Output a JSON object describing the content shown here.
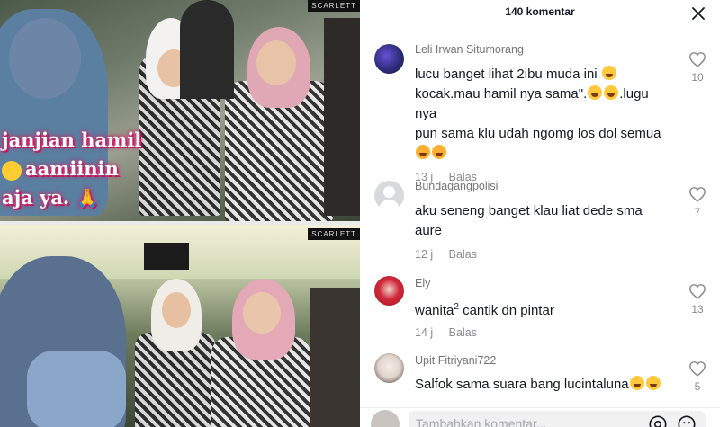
{
  "video": {
    "caption_lines": [
      "janjian hamil",
      "aamiinin",
      "aja ya."
    ],
    "watermark": "SCARLETT"
  },
  "panel": {
    "comment_count_title": "140 komentar",
    "comments": [
      {
        "username": "Leli Irwan Situmorang",
        "text": "lucu banget lihat 2ibu muda ini 😁 kocak.mau hamil nya sama\".😂😂.lugu nya pun sama klu udah ngomg los dol semua 🥰🥰",
        "text_parts": [
          "lucu banget lihat 2ibu muda ini",
          "kocak.mau hamil nya sama\".",
          ".lugu nya",
          "pun sama klu udah ngomg los dol semua"
        ],
        "time": "13 j",
        "reply_label": "Balas",
        "likes": "10"
      },
      {
        "username": "Bundagangpolisi",
        "text": "aku seneng banget klau liat dede sma aure",
        "text_parts": [
          "aku seneng banget klau liat dede sma",
          "aure"
        ],
        "time": "12 j",
        "reply_label": "Balas",
        "likes": "7"
      },
      {
        "username": "Ely",
        "text": "wanita² cantik dn pintar",
        "text_parts": [
          "wanita",
          "2",
          " cantik dn pintar"
        ],
        "time": "14 j",
        "reply_label": "Balas",
        "likes": "13"
      },
      {
        "username": "Upit Fitriyani722",
        "text": "Salfok sama suara bang lucintaluna😂😂",
        "text_parts": [
          "Salfok sama suara bang lucintaluna"
        ],
        "time": "",
        "reply_label": "",
        "likes": "5"
      }
    ],
    "composer": {
      "placeholder": "Tambahkan komentar..."
    }
  },
  "colors": {
    "accent": "#fe2c55",
    "text_primary": "#161823",
    "text_secondary": "#8a8b91",
    "caption_glow": "#d3236d"
  },
  "icons": [
    "close-icon",
    "heart-outline-icon",
    "at-mention-icon",
    "emoji-icon"
  ]
}
